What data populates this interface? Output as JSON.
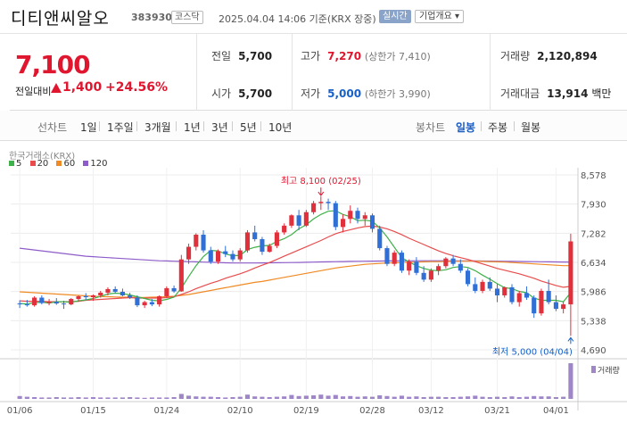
{
  "header": {
    "name": "디티앤씨알오",
    "code": "383930",
    "market": "코스닥",
    "timestamp": "2025.04.04 14:06 기준(KRX 장중)",
    "realtime": "실시간",
    "overview": "기업개요"
  },
  "summary": {
    "price": "7,100",
    "change_label": "전일대비",
    "change": "1,400",
    "change_pct": "+24.56%",
    "prev_label": "전일",
    "prev": "5,700",
    "open_label": "시가",
    "open": "5,700",
    "high_label": "고가",
    "high": "7,270",
    "upper_limit": "(상한가 7,410)",
    "low_label": "저가",
    "low": "5,000",
    "lower_limit": "(하한가 3,990)",
    "volume_label": "거래량",
    "volume": "2,120,894",
    "amount_label": "거래대금",
    "amount": "13,914",
    "amount_unit": "백만"
  },
  "periods": {
    "line_label": "선차트",
    "items": [
      "1일",
      "1주일",
      "3개월",
      "1년",
      "3년",
      "5년",
      "10년"
    ],
    "candle_label": "봉차트",
    "candle_items": [
      "일봉",
      "주봉",
      "월봉"
    ],
    "active_candle": "일봉"
  },
  "chart": {
    "source": "한국거래소(KRX)",
    "legend": [
      {
        "label": "5",
        "color": "#3fb14a"
      },
      {
        "label": "20",
        "color": "#e84c4c"
      },
      {
        "label": "60",
        "color": "#f08a24"
      },
      {
        "label": "120",
        "color": "#8e5cc9"
      }
    ],
    "high_annotation": "최고 8,100 (02/25)",
    "low_annotation": "최저 5,000 (04/04)",
    "volume_label": "거래량",
    "up_color": "#e0303c",
    "down_color": "#2f6fd6"
  },
  "chart_data": {
    "type": "candlestick",
    "y_ticks": [
      "8,578",
      "7,930",
      "7,282",
      "6,634",
      "5,986",
      "5,338",
      "4,690"
    ],
    "ylim": [
      4690,
      8578
    ],
    "x_ticks": [
      "01/06",
      "01/15",
      "01/24",
      "02/10",
      "02/19",
      "02/28",
      "03/12",
      "03/21",
      "04/01"
    ],
    "candles": [
      [
        5720,
        5790,
        5620,
        5700
      ],
      [
        5700,
        5800,
        5650,
        5680
      ],
      [
        5680,
        5880,
        5650,
        5850
      ],
      [
        5850,
        5900,
        5700,
        5730
      ],
      [
        5730,
        5820,
        5680,
        5760
      ],
      [
        5760,
        5840,
        5690,
        5720
      ],
      [
        5720,
        5780,
        5600,
        5700
      ],
      [
        5700,
        5840,
        5680,
        5820
      ],
      [
        5820,
        5900,
        5760,
        5880
      ],
      [
        5880,
        5950,
        5800,
        5860
      ],
      [
        5860,
        5920,
        5780,
        5900
      ],
      [
        5900,
        6000,
        5850,
        5960
      ],
      [
        5960,
        6080,
        5900,
        6040
      ],
      [
        6040,
        6100,
        5950,
        5980
      ],
      [
        5980,
        6050,
        5880,
        5900
      ],
      [
        5900,
        5960,
        5820,
        5850
      ],
      [
        5850,
        5900,
        5640,
        5680
      ],
      [
        5680,
        5780,
        5620,
        5750
      ],
      [
        5750,
        5820,
        5660,
        5700
      ],
      [
        5700,
        5900,
        5650,
        5880
      ],
      [
        5880,
        6100,
        5850,
        6060
      ],
      [
        6060,
        6120,
        5960,
        5990
      ],
      [
        5990,
        6800,
        5980,
        6700
      ],
      [
        6700,
        7050,
        6600,
        6980
      ],
      [
        6980,
        7280,
        6900,
        7250
      ],
      [
        7250,
        7350,
        6850,
        6900
      ],
      [
        6900,
        6980,
        6600,
        6650
      ],
      [
        6650,
        6920,
        6600,
        6880
      ],
      [
        6880,
        7000,
        6750,
        6820
      ],
      [
        6820,
        6900,
        6650,
        6700
      ],
      [
        6700,
        6950,
        6650,
        6900
      ],
      [
        6900,
        7350,
        6850,
        7300
      ],
      [
        7300,
        7450,
        7100,
        7150
      ],
      [
        7150,
        7200,
        6800,
        6870
      ],
      [
        6870,
        7050,
        6850,
        7000
      ],
      [
        7000,
        7350,
        6950,
        7300
      ],
      [
        7300,
        7500,
        7250,
        7450
      ],
      [
        7450,
        7700,
        7400,
        7680
      ],
      [
        7680,
        7800,
        7350,
        7450
      ],
      [
        7450,
        7800,
        7420,
        7750
      ],
      [
        7750,
        8000,
        7700,
        7950
      ],
      [
        7950,
        8100,
        7800,
        7980
      ],
      [
        7980,
        8050,
        7800,
        7950
      ],
      [
        7950,
        8000,
        7350,
        7420
      ],
      [
        7420,
        7700,
        7300,
        7600
      ],
      [
        7600,
        7900,
        7500,
        7780
      ],
      [
        7780,
        7850,
        7500,
        7600
      ],
      [
        7600,
        7750,
        7450,
        7680
      ],
      [
        7680,
        7720,
        7300,
        7380
      ],
      [
        7380,
        7450,
        6900,
        6950
      ],
      [
        6950,
        7000,
        6550,
        6600
      ],
      [
        6600,
        6900,
        6550,
        6850
      ],
      [
        6850,
        6900,
        6400,
        6450
      ],
      [
        6450,
        6700,
        6350,
        6650
      ],
      [
        6650,
        6750,
        6350,
        6400
      ],
      [
        6400,
        6550,
        6200,
        6250
      ],
      [
        6250,
        6500,
        6200,
        6450
      ],
      [
        6450,
        6600,
        6350,
        6550
      ],
      [
        6550,
        6750,
        6500,
        6720
      ],
      [
        6720,
        6800,
        6550,
        6600
      ],
      [
        6600,
        6700,
        6400,
        6450
      ],
      [
        6450,
        6500,
        6100,
        6150
      ],
      [
        6150,
        6300,
        5950,
        6000
      ],
      [
        6000,
        6250,
        5950,
        6200
      ],
      [
        6200,
        6300,
        6000,
        6050
      ],
      [
        6050,
        6150,
        5750,
        5900
      ],
      [
        5900,
        6100,
        5850,
        6080
      ],
      [
        6080,
        6150,
        5700,
        5750
      ],
      [
        5750,
        6000,
        5650,
        5950
      ],
      [
        5950,
        6100,
        5800,
        5850
      ],
      [
        5850,
        5900,
        5400,
        5500
      ],
      [
        5500,
        6050,
        5450,
        6000
      ],
      [
        6000,
        6250,
        5700,
        5750
      ],
      [
        5750,
        5900,
        5550,
        5600
      ],
      [
        5600,
        5760,
        5500,
        5700
      ],
      [
        5700,
        7270,
        5000,
        7100
      ]
    ],
    "volumes": [
      8,
      6,
      5,
      4,
      4,
      5,
      4,
      4,
      5,
      4,
      5,
      4,
      4,
      4,
      4,
      5,
      4,
      3,
      4,
      4,
      4,
      5,
      14,
      9,
      7,
      6,
      6,
      5,
      4,
      5,
      6,
      12,
      7,
      6,
      5,
      6,
      7,
      11,
      8,
      9,
      10,
      12,
      9,
      11,
      7,
      8,
      6,
      7,
      6,
      10,
      8,
      6,
      9,
      6,
      7,
      5,
      6,
      6,
      5,
      5,
      6,
      7,
      9,
      6,
      5,
      6,
      5,
      7,
      5,
      6,
      8,
      7,
      7,
      5,
      6,
      100
    ],
    "ma5": [
      5720,
      5710,
      5740,
      5750,
      5730,
      5760,
      5760,
      5750,
      5780,
      5800,
      5830,
      5880,
      5930,
      5950,
      5940,
      5910,
      5870,
      5830,
      5790,
      5780,
      5810,
      5860,
      6060,
      6320,
      6560,
      6760,
      6900,
      6890,
      6820,
      6780,
      6790,
      6920,
      6970,
      7000,
      7010,
      7100,
      7160,
      7250,
      7380,
      7470,
      7600,
      7700,
      7770,
      7780,
      7700,
      7650,
      7560,
      7570,
      7550,
      7400,
      7200,
      6970,
      6740,
      6640,
      6560,
      6500,
      6460,
      6450,
      6470,
      6520,
      6540,
      6520,
      6450,
      6350,
      6260,
      6160,
      6070,
      6050,
      5990,
      5960,
      5840,
      5790,
      5790,
      5790,
      5760,
      5960
    ],
    "ma20": [
      5780,
      5770,
      5770,
      5770,
      5760,
      5760,
      5760,
      5760,
      5770,
      5790,
      5800,
      5810,
      5820,
      5830,
      5840,
      5850,
      5840,
      5840,
      5840,
      5840,
      5850,
      5870,
      5920,
      5980,
      6050,
      6110,
      6170,
      6220,
      6280,
      6330,
      6380,
      6440,
      6510,
      6570,
      6630,
      6700,
      6770,
      6840,
      6910,
      6980,
      7050,
      7120,
      7200,
      7270,
      7320,
      7360,
      7400,
      7430,
      7440,
      7420,
      7380,
      7320,
      7250,
      7170,
      7100,
      7030,
      6960,
      6890,
      6830,
      6780,
      6740,
      6700,
      6650,
      6600,
      6550,
      6500,
      6460,
      6420,
      6380,
      6330,
      6280,
      6220,
      6170,
      6120,
      6080,
      6100
    ],
    "ma60": [
      5980,
      5970,
      5960,
      5950,
      5940,
      5930,
      5920,
      5910,
      5900,
      5890,
      5880,
      5875,
      5870,
      5865,
      5860,
      5860,
      5855,
      5855,
      5860,
      5865,
      5870,
      5880,
      5900,
      5920,
      5950,
      5980,
      6010,
      6040,
      6070,
      6100,
      6130,
      6160,
      6190,
      6210,
      6240,
      6270,
      6300,
      6330,
      6360,
      6390,
      6420,
      6450,
      6480,
      6510,
      6530,
      6550,
      6570,
      6590,
      6600,
      6610,
      6620,
      6625,
      6630,
      6635,
      6640,
      6645,
      6650,
      6650,
      6655,
      6655,
      6660,
      6660,
      6660,
      6655,
      6650,
      6645,
      6640,
      6630,
      6620,
      6610,
      6600,
      6590,
      6580,
      6570,
      6560,
      6560
    ],
    "ma120": [
      6950,
      6930,
      6910,
      6890,
      6870,
      6850,
      6830,
      6810,
      6790,
      6770,
      6760,
      6750,
      6740,
      6730,
      6720,
      6710,
      6700,
      6690,
      6680,
      6670,
      6665,
      6660,
      6655,
      6650,
      6645,
      6640,
      6635,
      6630,
      6625,
      6620,
      6620,
      6620,
      6620,
      6622,
      6624,
      6626,
      6628,
      6630,
      6633,
      6636,
      6640,
      6643,
      6646,
      6650,
      6652,
      6655,
      6657,
      6660,
      6662,
      6664,
      6665,
      6666,
      6667,
      6668,
      6669,
      6670,
      6670,
      6670,
      6669,
      6668,
      6667,
      6666,
      6665,
      6664,
      6662,
      6660,
      6658,
      6656,
      6654,
      6652,
      6650,
      6648,
      6646,
      6644,
      6642,
      6640
    ]
  }
}
